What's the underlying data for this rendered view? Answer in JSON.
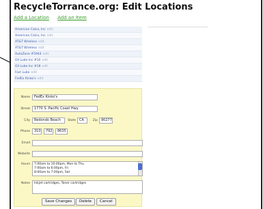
{
  "page": {
    "title": "RecycleTorrance.org: Edit Locations",
    "add_location_link": "Add a Location",
    "add_item_link": "Add an Item"
  },
  "locations": [
    {
      "name": "American Calco, Inc",
      "edit": "edit"
    },
    {
      "name": "American Calco, Inc",
      "edit": "edit"
    },
    {
      "name": "AT&T Wireless",
      "edit": "edit"
    },
    {
      "name": "AT&T Wireless",
      "edit": "edit"
    },
    {
      "name": "AutoZone #5944",
      "edit": "edit"
    },
    {
      "name": "Oil Lube Inc #10",
      "edit": "edit"
    },
    {
      "name": "Oil Lube Inc #18",
      "edit": "edit"
    },
    {
      "name": "Fast Lube",
      "edit": "edit"
    },
    {
      "name": "FedEx Kinko's",
      "edit": "edit"
    }
  ],
  "form": {
    "name_label": "Name",
    "name_value": "FedEx Kinko's",
    "street_label": "Street",
    "street_value": "1770 S. Pacific Coast Hwy",
    "city_label": "City",
    "city_value": "Redondo Beach",
    "state_label": "State",
    "state_value": "CA",
    "zip_label": "Zip",
    "zip_value": "90277",
    "phone_label": "Phone",
    "phone_area": "310",
    "phone_prefix": "792",
    "phone_line": "8635",
    "email_label": "Email",
    "email_value": "",
    "website_label": "Website",
    "website_value": "",
    "hours_label": "Hours",
    "hours_lines": [
      "7:00am to 10:00pm, Mon to Thu",
      "7:00am to 6:00pm, Fri",
      "8:00am to 7:00pm, Sat"
    ],
    "notes_label": "Notes",
    "notes_value": "Inkjet cartridges, Toner cartridges"
  },
  "buttons": {
    "save": "Save Changes",
    "delete": "Delete",
    "cancel": "Cancel"
  }
}
